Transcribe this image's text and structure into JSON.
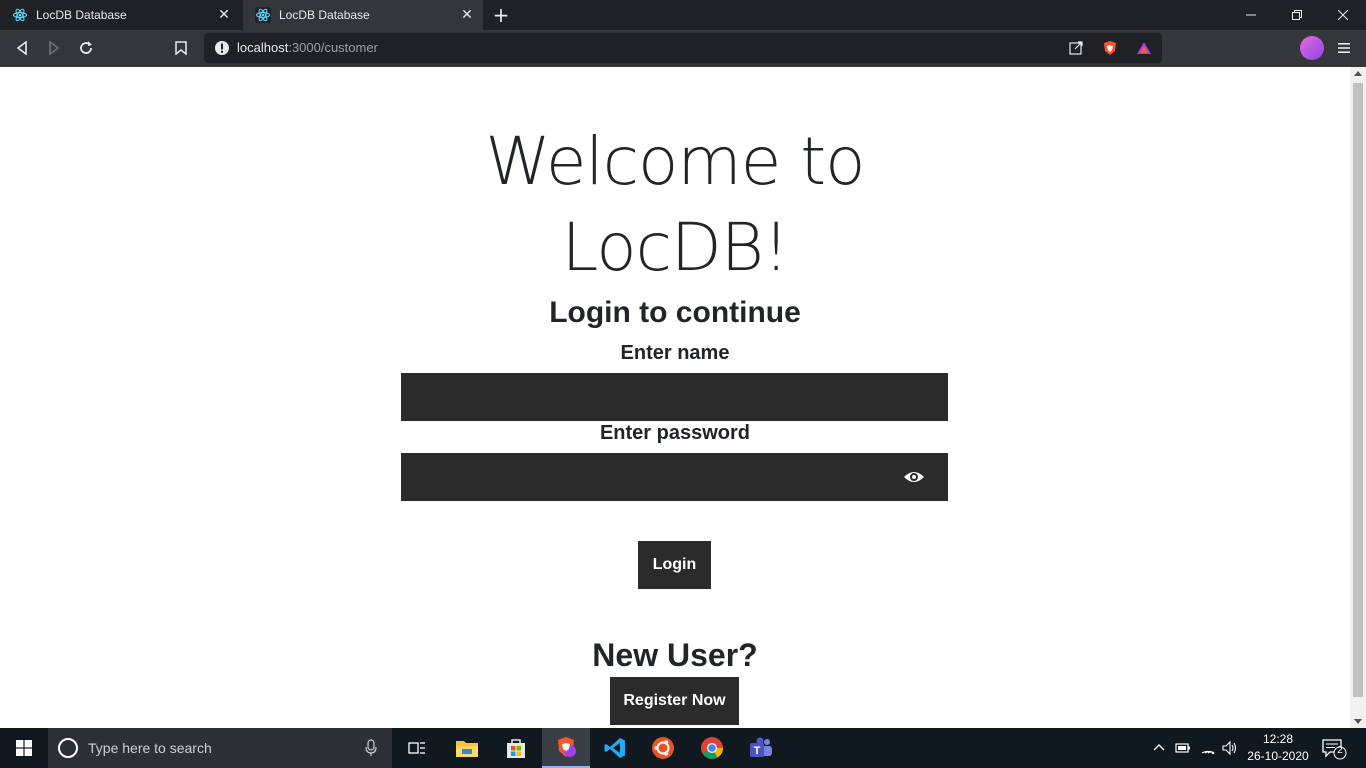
{
  "browser": {
    "tabs": [
      {
        "title": "LocDB Database",
        "active": false
      },
      {
        "title": "LocDB Database",
        "active": true
      }
    ],
    "url_host": "localhost",
    "url_path": ":3000/customer"
  },
  "page": {
    "welcome_line1": "Welcome to",
    "welcome_line2": "LocDB!",
    "login_heading": "Login to continue",
    "name_label": "Enter name",
    "name_value": "",
    "password_label": "Enter password",
    "password_value": "",
    "login_button": "Login",
    "new_user_heading": "New User?",
    "register_button": "Register Now"
  },
  "taskbar": {
    "search_placeholder": "Type here to search",
    "time": "12:28",
    "date": "26-10-2020",
    "notification_count": "2"
  },
  "colors": {
    "field_bg": "#2b2b2b",
    "button_bg": "#2b2b2b",
    "heading_text": "#212529"
  },
  "icons": {
    "tab_favicon": "react-atom-icon",
    "password_toggle": "eye-icon",
    "taskbar_apps": [
      "task-view-icon",
      "file-explorer-icon",
      "store-icon",
      "brave-icon",
      "vscode-icon",
      "ubuntu-icon",
      "chrome-icon",
      "teams-icon"
    ]
  }
}
